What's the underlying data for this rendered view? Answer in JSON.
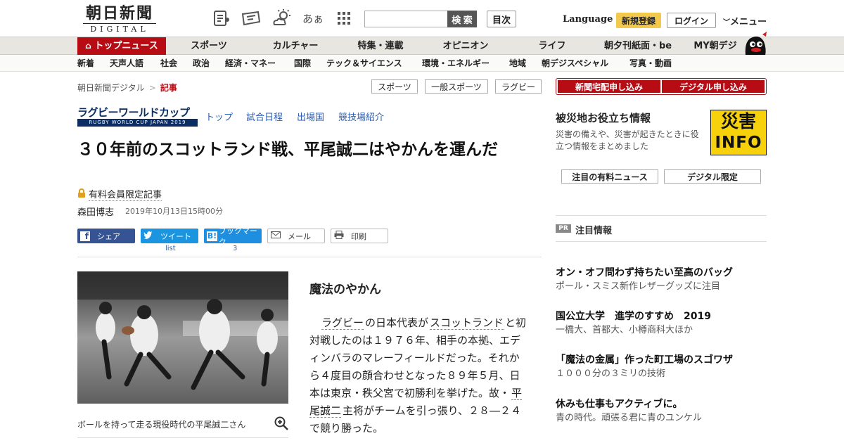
{
  "header": {
    "logo_main": "朝日新聞",
    "logo_sub": "DIGITAL",
    "font_size_icon_label": "あぁ",
    "search_placeholder": "",
    "search_button": "検 索",
    "toc_button": "目次",
    "language": "Language",
    "register": "新規登録",
    "login": "ログイン",
    "menu": "メニュー"
  },
  "nav_primary": [
    "トップニュース",
    "スポーツ",
    "カルチャー",
    "特集・連載",
    "オピニオン",
    "ライフ",
    "朝夕刊紙面・be",
    "MY朝デジ"
  ],
  "nav_secondary": [
    "新着",
    "天声人語",
    "社会",
    "政治",
    "経済・マネー",
    "国際",
    "テック＆サイエンス",
    "環境・エネルギー",
    "地域",
    "朝デジスペシャル",
    "写真・動画"
  ],
  "breadcrumb": {
    "home": "朝日新聞デジタル",
    "separator": ">",
    "current": "記事"
  },
  "tags": [
    "スポーツ",
    "一般スポーツ",
    "ラグビー"
  ],
  "rwc": {
    "logo_title": "ラグビーワールドカップ",
    "logo_sub": "RUGBY WORLD CUP JAPAN 2019",
    "links": [
      "トップ",
      "試合日程",
      "出場国",
      "競技場紹介"
    ]
  },
  "article": {
    "headline": "３０年前のスコットランド戦、平尾誠二はやかんを運んだ",
    "paid_label": "有料会員限定記事",
    "author": "森田博志",
    "datetime": "2019年10月13日15時00分",
    "caption": "ボールを持って走る現役時代の平尾誠二さん",
    "section_heading": "魔法のやかん",
    "body": {
      "kw1": "ラグビー",
      "t1": "の日本代表が",
      "kw2": "スコットランド",
      "t2": "と初対戦したのは１９７６年、相手の本拠、エディンバラのマレーフィールドだった。それから４度目の顔合わせとなった８９年５月、日本は東京・秩父宮で初勝利を挙げた。故・",
      "kw3": "平尾誠二",
      "t3": "主将がチームを引っ張り、２８―２４で競り勝った。"
    }
  },
  "share": {
    "facebook": "シェア",
    "twitter": "ツイート",
    "twitter_count": "list",
    "hatena": "ブックマーク",
    "hatena_count": "3",
    "mail": "メール",
    "print": "印刷"
  },
  "sidebar": {
    "subscribe_paper": "新聞宅配申し込み",
    "subscribe_digital": "デジタル申し込み",
    "disaster_title": "被災地お役立ち情報",
    "disaster_desc": "災害の備えや、災害が起きたときに役立つ情報をまとめました",
    "disaster_badge_kanji": "災害",
    "disaster_badge_info": "INFO",
    "btn_paid_news": "注目の有料ニュース",
    "btn_digital_only": "デジタル限定",
    "pr_label": "PR",
    "featured_heading": "注目情報",
    "featured": [
      {
        "title": "オン・オフ問わず持ちたい至高のバッグ",
        "sub": "ポール・スミス新作レザーグッズに注目"
      },
      {
        "title": "国公立大学　進学のすすめ　2019",
        "sub": "一橋大、首都大、小樽商科大ほか"
      },
      {
        "title": "「魔法の金属」作った町工場のスゴワザ",
        "sub": "１０００分の３ミリの技術"
      },
      {
        "title": "休みも仕事もアクティブに。",
        "sub": "青の時代。頑張る君に青のユンケル"
      }
    ]
  },
  "colors": {
    "brand_red": "#b80c14",
    "register_yellow": "#f2c94c",
    "link_blue": "#2a5db0"
  }
}
